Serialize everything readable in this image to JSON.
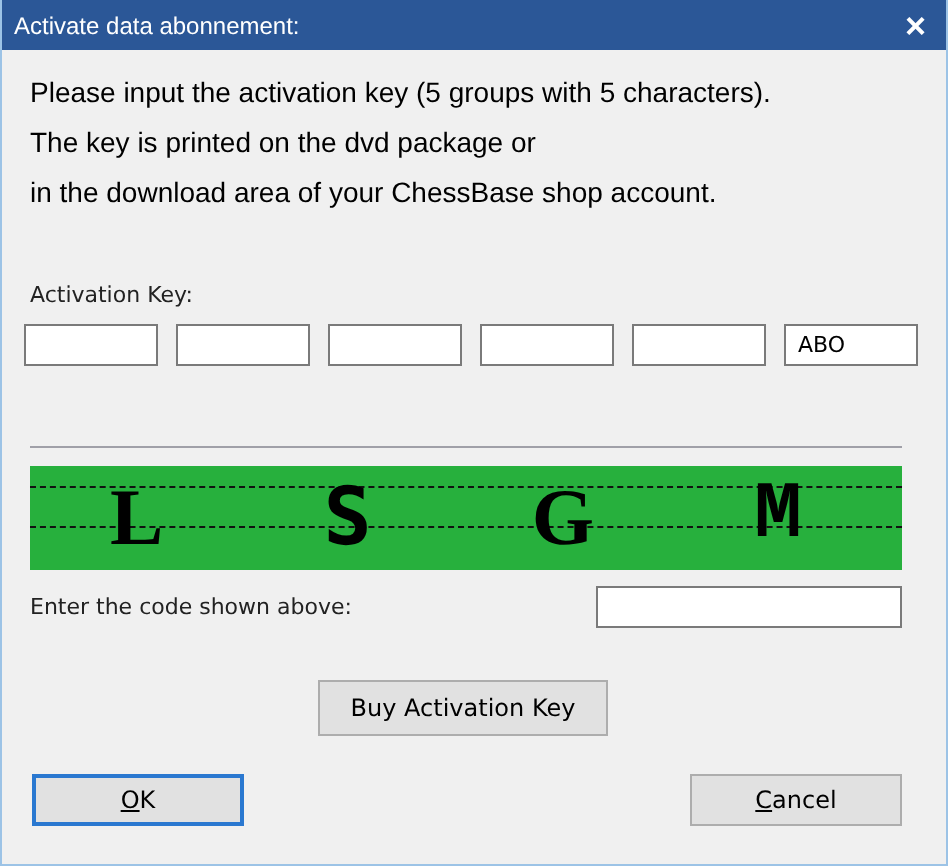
{
  "window": {
    "title": "Activate data abonnement:",
    "close_glyph": "×"
  },
  "instructions": [
    "Please input the activation key (5 groups with 5 characters).",
    "The key is printed on the dvd package or",
    "in the download area of your ChessBase shop account."
  ],
  "activation_key": {
    "label": "Activation Key:",
    "groups": [
      {
        "kind": "empty"
      },
      {
        "kind": "empty"
      },
      {
        "kind": "empty"
      },
      {
        "kind": "empty"
      },
      {
        "kind": "empty"
      },
      {
        "kind": "filled",
        "value": "ABO"
      }
    ]
  },
  "captcha": {
    "characters": [
      "L",
      "S",
      "G",
      "M"
    ]
  },
  "code_field": {
    "label": "Enter the code shown above:"
  },
  "buy_button": {
    "label": "Buy Activation Key"
  },
  "buttons": [
    {
      "kind": "default",
      "mnemonic": "O",
      "rest": "K"
    },
    {
      "kind": "normal",
      "mnemonic": "C",
      "rest": "ancel"
    }
  ]
}
